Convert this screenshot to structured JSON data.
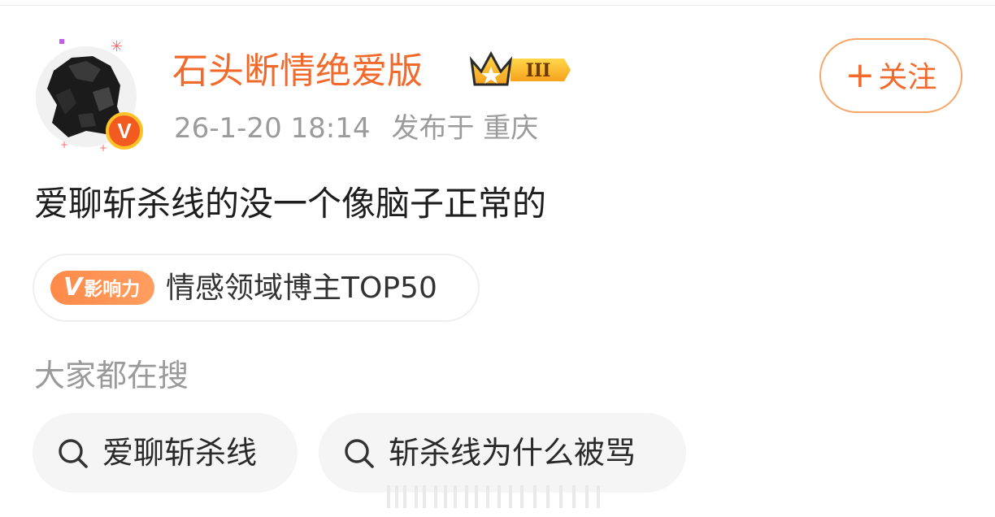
{
  "author": {
    "name": "石头断情绝爱版",
    "verified_badge": "V",
    "crown_level": "III",
    "follow_label": "关注",
    "follow_icon": "plus-icon"
  },
  "post": {
    "time": "26-1-20 18:14",
    "location": "发布于 重庆",
    "text": "爱聊斩杀线的没一个像脑子正常的"
  },
  "influence": {
    "badge_v": "V",
    "badge_text": "影响力",
    "description": "情感领域博主TOP50"
  },
  "search": {
    "title": "大家都在搜",
    "chips": [
      {
        "label": "爱聊斩杀线",
        "icon": "search-icon"
      },
      {
        "label": "斩杀线为什么被骂",
        "icon": "search-icon"
      }
    ]
  },
  "colors": {
    "accent": "#f2692c",
    "muted": "#9b9b9b",
    "chip_bg": "#f5f5f5"
  }
}
